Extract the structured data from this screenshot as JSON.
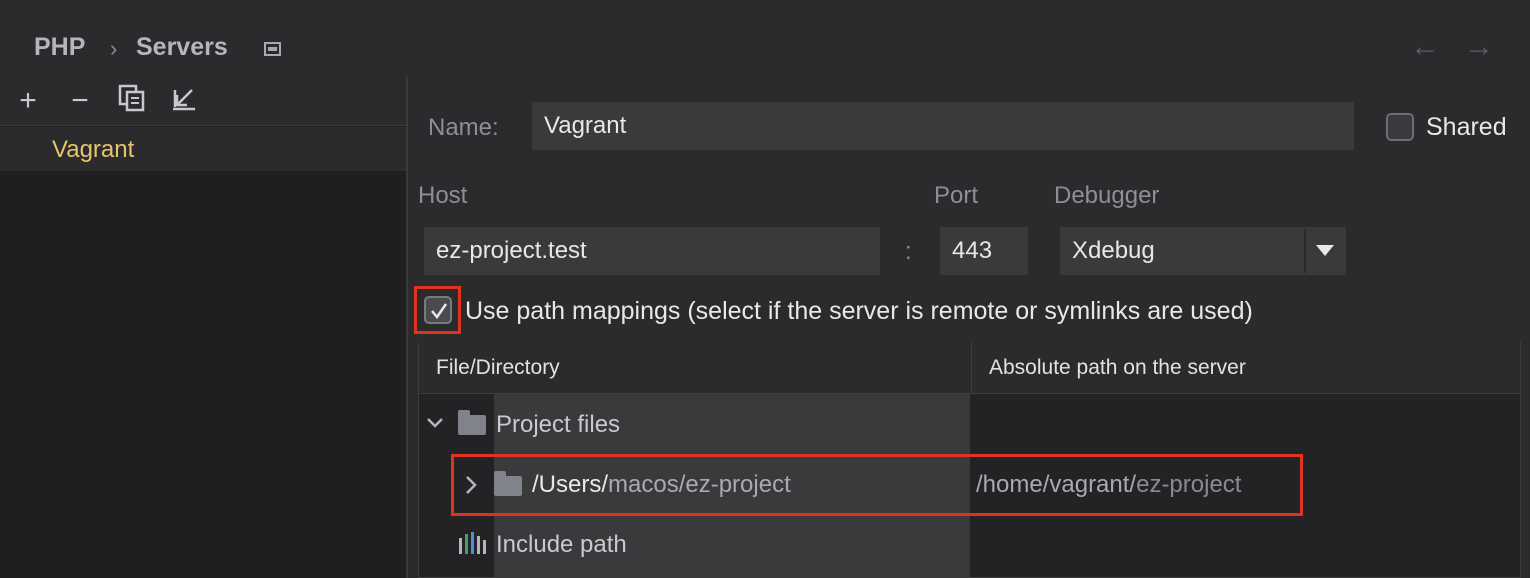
{
  "breadcrumb": {
    "parent": "PHP",
    "separator": "›",
    "current": "Servers"
  },
  "nav": {
    "back": "←",
    "forward": "→"
  },
  "toolbar": {
    "add": "+",
    "remove": "−"
  },
  "servers": [
    {
      "label": "Vagrant",
      "selected": true
    }
  ],
  "form": {
    "name_label": "Name:",
    "name_value": "Vagrant",
    "shared_label": "Shared",
    "shared_checked": false,
    "host_label": "Host",
    "host_value": "ez-project.test",
    "port_label": "Port",
    "port_sep": ":",
    "port_value": "443",
    "debugger_label": "Debugger",
    "debugger_value": "Xdebug",
    "path_mapping_label": "Use path mappings (select if the server is remote or symlinks are used)",
    "path_mapping_checked": true
  },
  "mappings": {
    "columns": [
      "File/Directory",
      "Absolute path on the server"
    ],
    "project_files_label": "Project files",
    "local_path_bold": "/Users/",
    "local_path_rest": "macos/ez-project",
    "server_path_bold": "/home/vagrant/",
    "server_path_rest": "ez-project",
    "include_path_label": "Include path"
  },
  "colors": {
    "selected_server": "#e6c46a",
    "highlight_border": "#e0321f",
    "background": "#2b2b2d"
  }
}
